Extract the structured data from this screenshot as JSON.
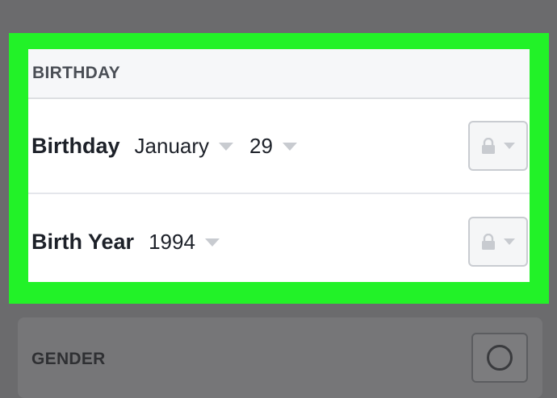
{
  "birthday_section": {
    "header": "BIRTHDAY",
    "rows": [
      {
        "label": "Birthday",
        "month": "January",
        "day": "29",
        "privacy_icon": "lock-icon"
      },
      {
        "label": "Birth Year",
        "year": "1994",
        "privacy_icon": "lock-icon"
      }
    ]
  },
  "gender_section": {
    "header": "GENDER",
    "selector_icon": "radio-circle-icon"
  },
  "colors": {
    "highlight": "#22f228",
    "overlay": "#6b6b6d",
    "text": "#1d2129",
    "header_text": "#4b4f56"
  }
}
